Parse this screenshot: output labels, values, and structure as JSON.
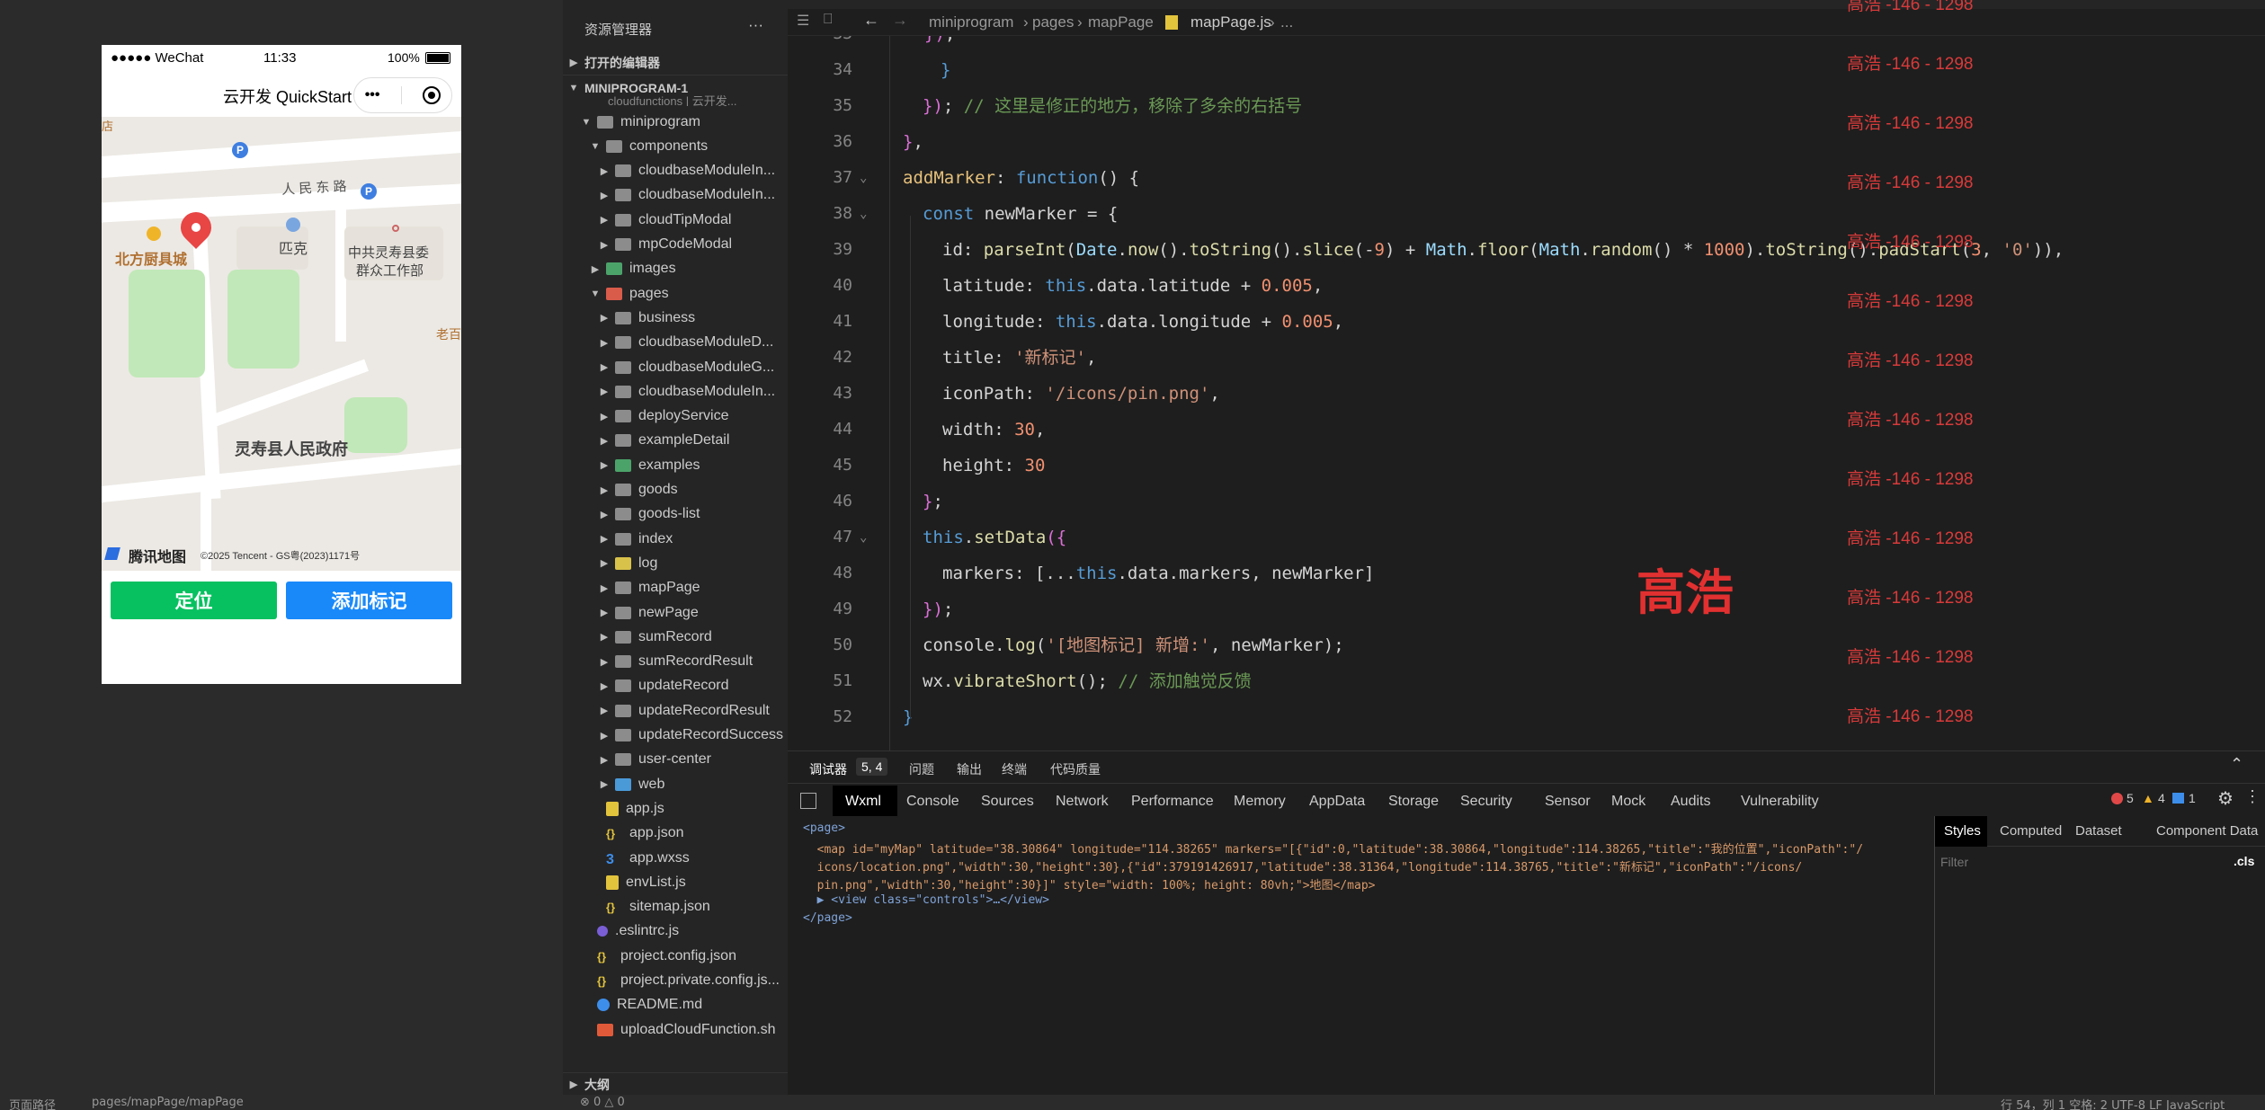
{
  "simulator": {
    "status": {
      "carrier": "●●●●● WeChat",
      "time": "11:33",
      "battery": "100%"
    },
    "nav_title": "云开发 QuickStart",
    "capsule_more": "•••",
    "map": {
      "road": "人 民 东 路",
      "poi1": "北方厨具城",
      "poi2": "匹克",
      "poi3_line1": "中共灵寿县委",
      "poi3_line2": "群众工作部",
      "poi4": "灵寿县人民政府",
      "poi5": "老百",
      "poi6": "店",
      "parking": "P",
      "brand": "腾讯地图",
      "copyright": "©2025 Tencent - GS粤(2023)1171号"
    },
    "locate_button": "定位",
    "add_marker_button": "添加标记"
  },
  "explorer": {
    "title": "资源管理器",
    "more": "···",
    "open_editors": "打开的编辑器",
    "project": "MINIPROGRAM-1",
    "truncated_top": "cloudfunctions | 云开发...",
    "items": [
      {
        "label": "miniprogram",
        "depth": 1,
        "type": "folder-open"
      },
      {
        "label": "components",
        "depth": 2,
        "type": "folder-open"
      },
      {
        "label": "cloudbaseModuleIn...",
        "depth": 3,
        "type": "folder"
      },
      {
        "label": "cloudbaseModuleIn...",
        "depth": 3,
        "type": "folder"
      },
      {
        "label": "cloudTipModal",
        "depth": 3,
        "type": "folder"
      },
      {
        "label": "mpCodeModal",
        "depth": 3,
        "type": "folder"
      },
      {
        "label": "images",
        "depth": 2,
        "type": "folder-green"
      },
      {
        "label": "pages",
        "depth": 2,
        "type": "folder-red-open"
      },
      {
        "label": "business",
        "depth": 3,
        "type": "folder"
      },
      {
        "label": "cloudbaseModuleD...",
        "depth": 3,
        "type": "folder"
      },
      {
        "label": "cloudbaseModuleG...",
        "depth": 3,
        "type": "folder"
      },
      {
        "label": "cloudbaseModuleIn...",
        "depth": 3,
        "type": "folder"
      },
      {
        "label": "deployService",
        "depth": 3,
        "type": "folder"
      },
      {
        "label": "exampleDetail",
        "depth": 3,
        "type": "folder"
      },
      {
        "label": "examples",
        "depth": 3,
        "type": "folder-green"
      },
      {
        "label": "goods",
        "depth": 3,
        "type": "folder"
      },
      {
        "label": "goods-list",
        "depth": 3,
        "type": "folder"
      },
      {
        "label": "index",
        "depth": 3,
        "type": "folder"
      },
      {
        "label": "log",
        "depth": 3,
        "type": "folder-yellow"
      },
      {
        "label": "mapPage",
        "depth": 3,
        "type": "folder"
      },
      {
        "label": "newPage",
        "depth": 3,
        "type": "folder"
      },
      {
        "label": "sumRecord",
        "depth": 3,
        "type": "folder"
      },
      {
        "label": "sumRecordResult",
        "depth": 3,
        "type": "folder"
      },
      {
        "label": "updateRecord",
        "depth": 3,
        "type": "folder"
      },
      {
        "label": "updateRecordResult",
        "depth": 3,
        "type": "folder"
      },
      {
        "label": "updateRecordSuccess",
        "depth": 3,
        "type": "folder"
      },
      {
        "label": "user-center",
        "depth": 3,
        "type": "folder"
      },
      {
        "label": "web",
        "depth": 3,
        "type": "folder-blue"
      },
      {
        "label": "app.js",
        "depth": 2,
        "type": "js"
      },
      {
        "label": "app.json",
        "depth": 2,
        "type": "json"
      },
      {
        "label": "app.wxss",
        "depth": 2,
        "type": "wxss"
      },
      {
        "label": "envList.js",
        "depth": 2,
        "type": "js"
      },
      {
        "label": "sitemap.json",
        "depth": 2,
        "type": "json"
      },
      {
        "label": ".eslintrc.js",
        "depth": 1,
        "type": "eslint"
      },
      {
        "label": "project.config.json",
        "depth": 1,
        "type": "json"
      },
      {
        "label": "project.private.config.js...",
        "depth": 1,
        "type": "json"
      },
      {
        "label": "README.md",
        "depth": 1,
        "type": "info"
      },
      {
        "label": "uploadCloudFunction.sh",
        "depth": 1,
        "type": "sh"
      }
    ],
    "outline": "大纲"
  },
  "editor": {
    "breadcrumb": [
      "miniprogram",
      "pages",
      "mapPage",
      "mapPage.js",
      "..."
    ],
    "watermark_small": "高浩 -146 - 1298",
    "watermark_big": "高浩",
    "lines": [
      {
        "n": "33",
        "code": "      });"
      },
      {
        "n": "34",
        "code": "    }"
      },
      {
        "n": "35",
        "code": "  }); // 这里是修正的地方，移除了多余的右括号"
      },
      {
        "n": "36",
        "code": "},"
      },
      {
        "n": "37",
        "code": "addMarker: function() {"
      },
      {
        "n": "38",
        "code": "  const newMarker = {"
      },
      {
        "n": "39",
        "code": "    id: parseInt(Date.now().toString().slice(-9) + Math.floor(Math.random() * 1000).toString().padStart(3, '0')),"
      },
      {
        "n": "40",
        "code": "    latitude: this.data.latitude + 0.005,"
      },
      {
        "n": "41",
        "code": "    longitude: this.data.longitude + 0.005,"
      },
      {
        "n": "42",
        "code": "    title: '新标记',"
      },
      {
        "n": "43",
        "code": "    iconPath: '/icons/pin.png',"
      },
      {
        "n": "44",
        "code": "    width: 30,"
      },
      {
        "n": "45",
        "code": "    height: 30"
      },
      {
        "n": "46",
        "code": "  };"
      },
      {
        "n": "47",
        "code": "  this.setData({"
      },
      {
        "n": "48",
        "code": "    markers: [...this.data.markers, newMarker]"
      },
      {
        "n": "49",
        "code": "  });"
      },
      {
        "n": "50",
        "code": "  console.log('[地图标记] 新增:', newMarker);"
      },
      {
        "n": "51",
        "code": "  wx.vibrateShort(); // 添加触觉反馈"
      },
      {
        "n": "52",
        "code": "}"
      }
    ]
  },
  "devtools": {
    "top_tabs": [
      "调试器",
      "5, 4",
      "问题",
      "输出",
      "终端",
      "代码质量"
    ],
    "tabs": [
      "Wxml",
      "Console",
      "Sources",
      "Network",
      "Performance",
      "Memory",
      "AppData",
      "Storage",
      "Security",
      "Sensor",
      "Mock",
      "Audits",
      "Vulnerability"
    ],
    "errors": "5",
    "warnings": "4",
    "infos": "1",
    "side_tabs": [
      "Styles",
      "Computed",
      "Dataset",
      "Component Data"
    ],
    "filter_placeholder": "Filter",
    "cls": ".cls",
    "wxml": [
      "<page>",
      "  <map id=\"myMap\" latitude=\"38.30864\" longitude=\"114.38265\" markers=\"[{\"id\":0,\"latitude\":38.30864,\"longitude\":114.38265,\"title\":\"我的位置\",\"iconPath\":\"/",
      "  icons/location.png\",\"width\":30,\"height\":30},{\"id\":379191426917,\"latitude\":38.31364,\"longitude\":114.38765,\"title\":\"新标记\",\"iconPath\":\"/icons/",
      "  pin.png\",\"width\":30,\"height\":30}]\" style=\"width: 100%; height: 80vh;\">地图</map>",
      "  ▶ <view class=\"controls\">…</view>",
      "</page>"
    ]
  },
  "statusbar": {
    "left1": "页面路径",
    "left2": "pages/mapPage/mapPage",
    "center": "⊗ 0 △ 0",
    "right": "行 54，列 1   空格: 2   UTF-8   LF   JavaScript"
  }
}
